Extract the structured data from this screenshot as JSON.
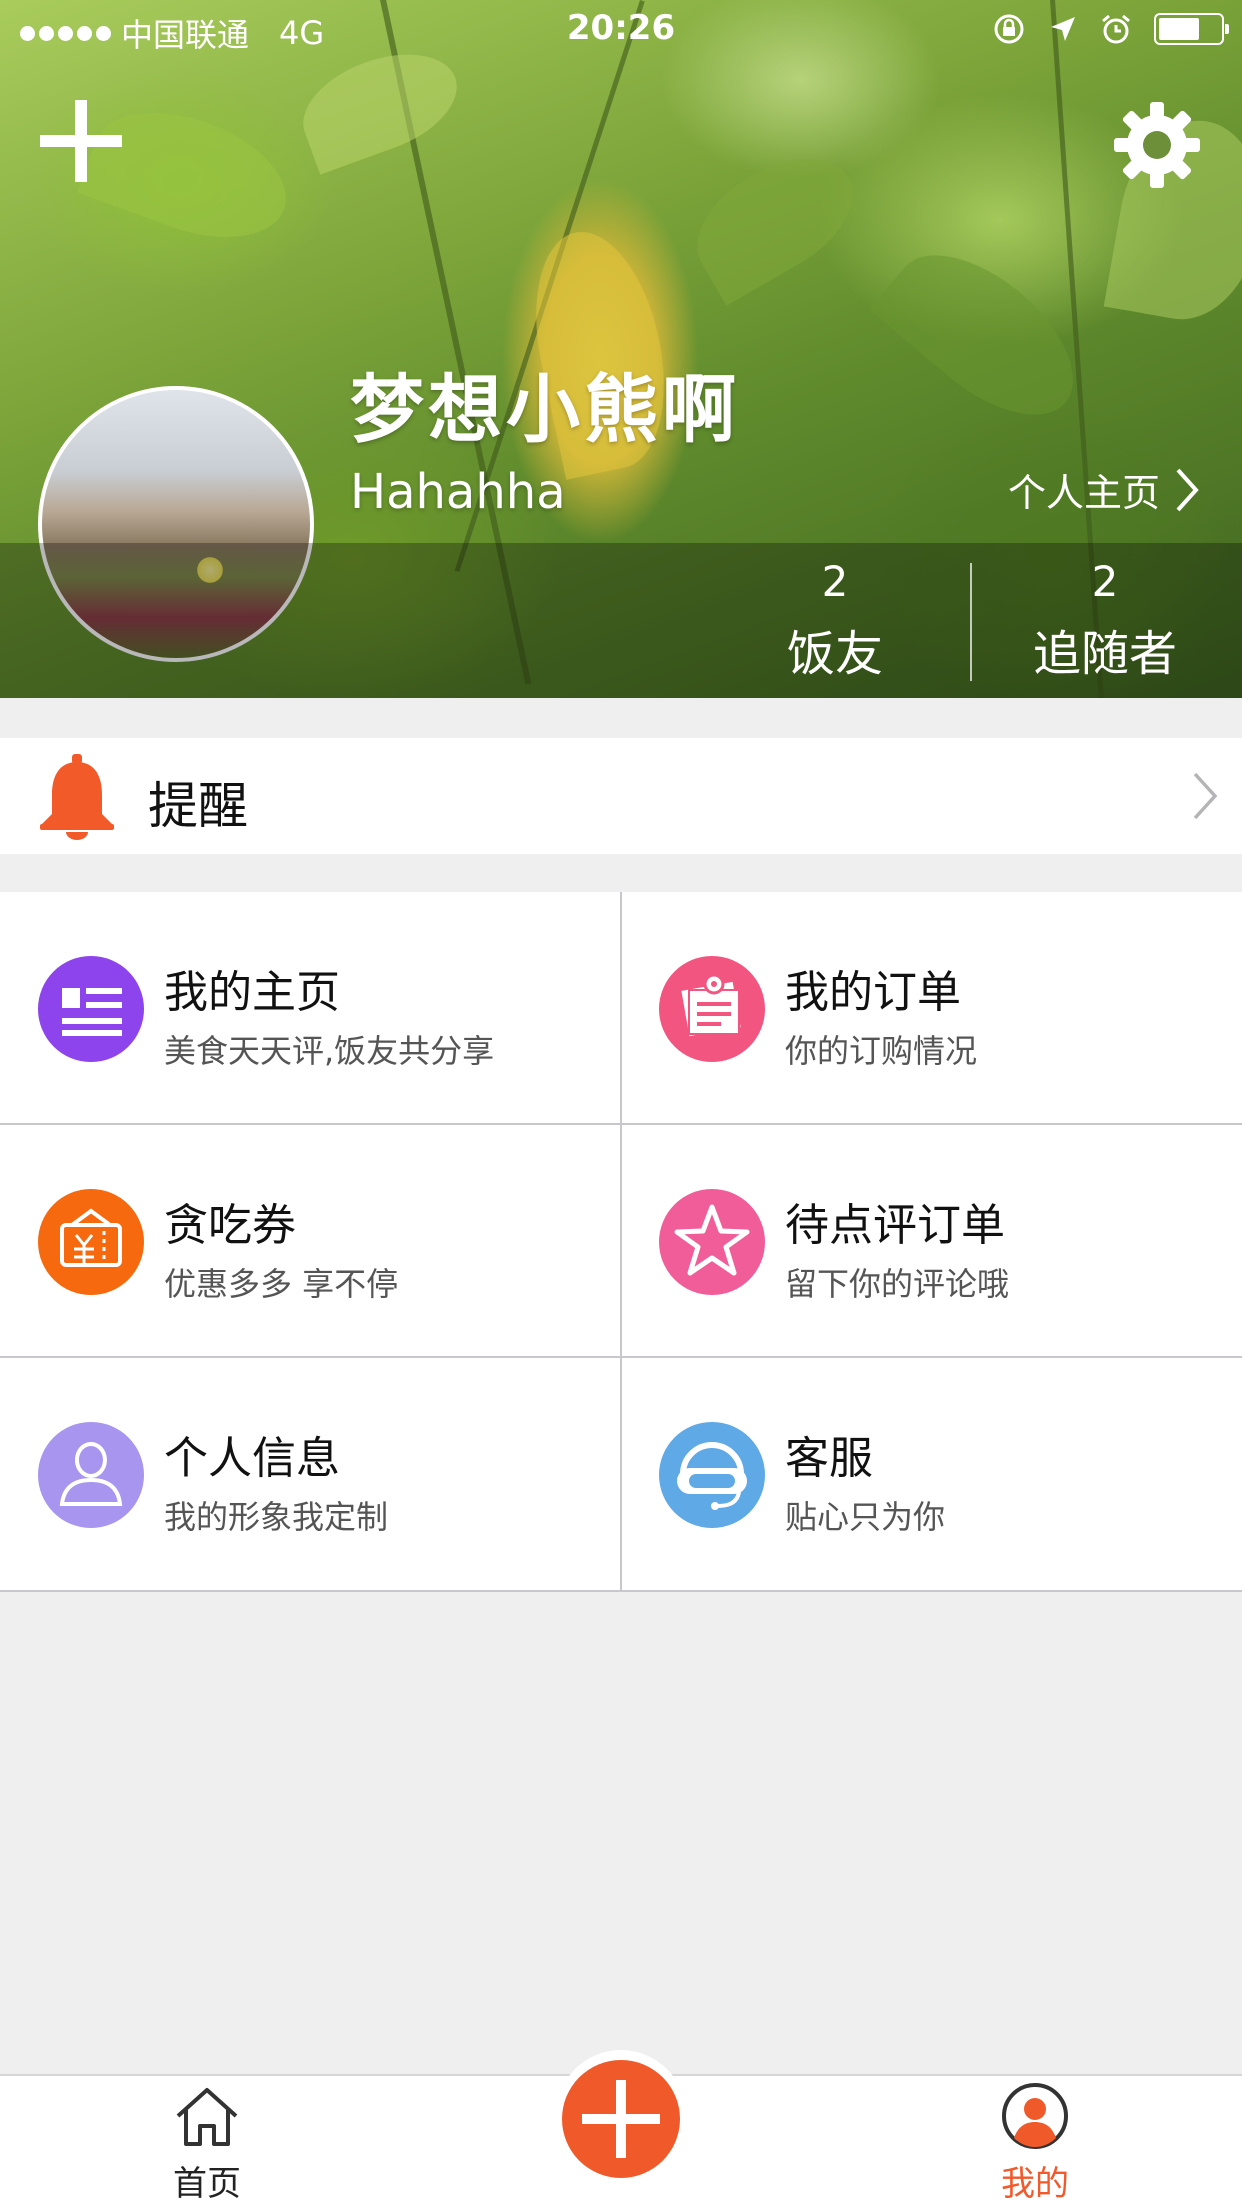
{
  "status_bar": {
    "carrier": "中国联通",
    "network": "4G",
    "time": "20:26"
  },
  "profile": {
    "nickname": "梦想小熊啊",
    "signature": "Hahahha",
    "home_link": "个人主页",
    "stats": [
      {
        "value": "2",
        "label": "饭友"
      },
      {
        "value": "2",
        "label": "追随者"
      }
    ]
  },
  "reminder": {
    "label": "提醒",
    "icon": "bell-icon",
    "color": "#f25a2a"
  },
  "menu": [
    {
      "title": "我的主页",
      "subtitle": "美食天天评,饭友共分享",
      "icon": "profile-card-icon",
      "color": "#8e44ec"
    },
    {
      "title": "我的订单",
      "subtitle": "你的订购情况",
      "icon": "order-notes-icon",
      "color": "#f2557f"
    },
    {
      "title": "贪吃券",
      "subtitle": "优惠多多 享不停",
      "icon": "coupon-icon",
      "color": "#f7690f"
    },
    {
      "title": "待点评订单",
      "subtitle": "留下你的评论哦",
      "icon": "star-icon",
      "color": "#f15d98"
    },
    {
      "title": "个人信息",
      "subtitle": "我的形象我定制",
      "icon": "person-icon",
      "color": "#a895ef"
    },
    {
      "title": "客服",
      "subtitle": "贴心只为你",
      "icon": "headset-icon",
      "color": "#5fa9e6"
    }
  ],
  "tabbar": {
    "home": "首页",
    "mine": "我的",
    "accent": "#f05a2a"
  }
}
